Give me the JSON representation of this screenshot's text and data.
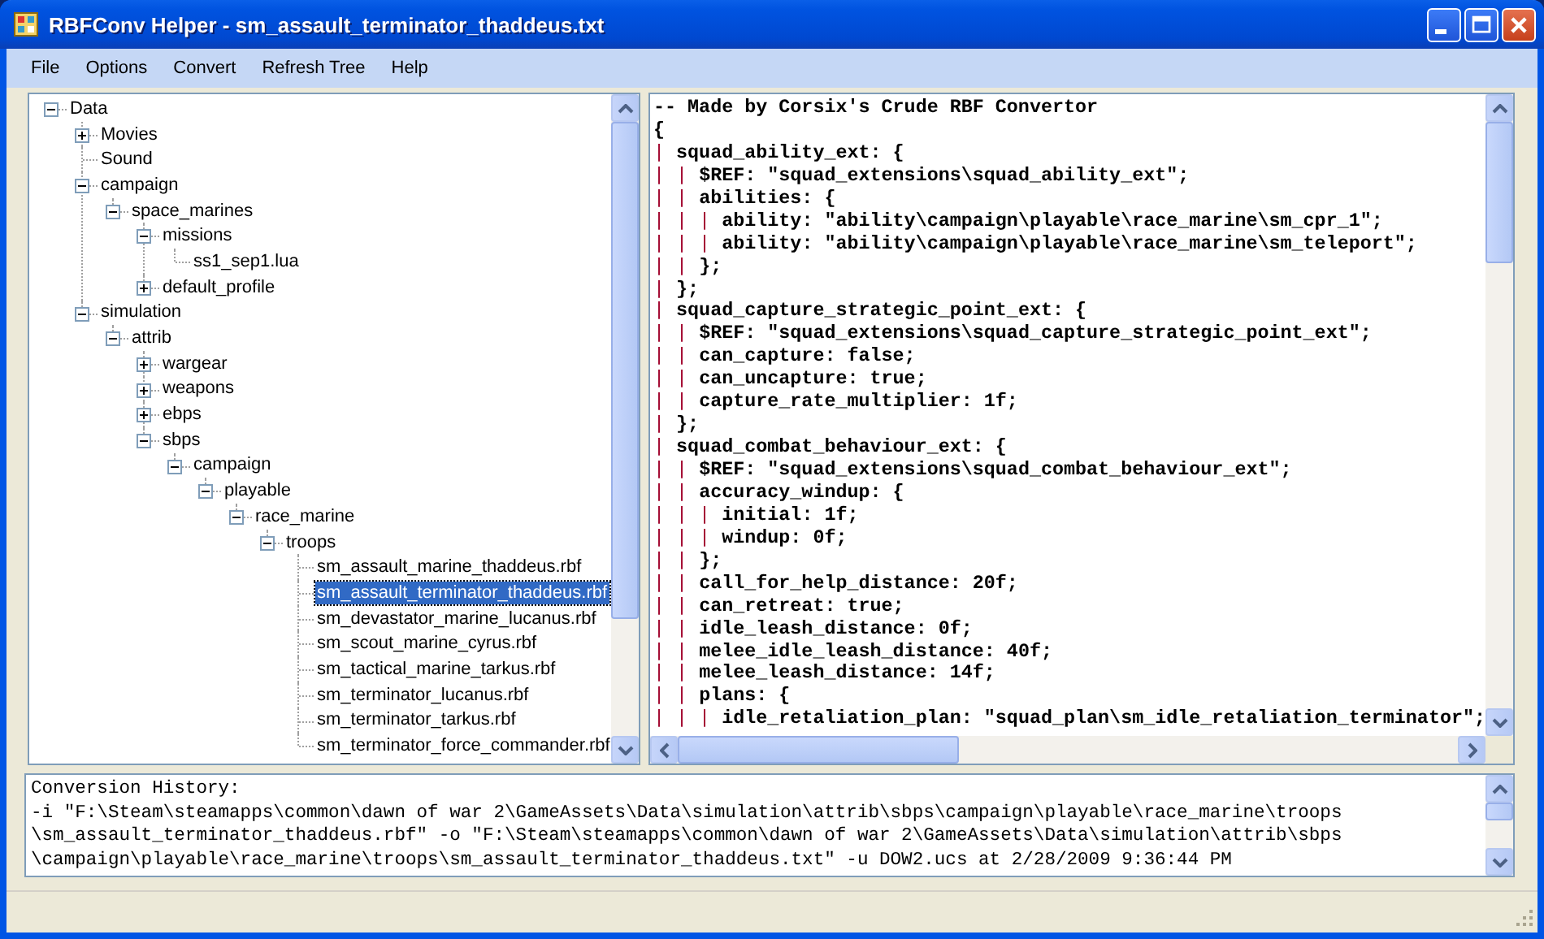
{
  "window": {
    "title": "RBFConv Helper - sm_assault_terminator_thaddeus.txt"
  },
  "menu": [
    "File",
    "Options",
    "Convert",
    "Refresh Tree",
    "Help"
  ],
  "tree": [
    {
      "label": "Data",
      "expanded": true,
      "selected": false,
      "children": [
        {
          "label": "Movies",
          "expanded": false,
          "selected": false
        },
        {
          "label": "Sound",
          "selected": false
        },
        {
          "label": "campaign",
          "expanded": true,
          "selected": false,
          "children": [
            {
              "label": "space_marines",
              "expanded": true,
              "selected": false,
              "children": [
                {
                  "label": "missions",
                  "expanded": true,
                  "selected": false,
                  "children": [
                    {
                      "label": "ss1_sep1.lua",
                      "selected": false
                    }
                  ]
                },
                {
                  "label": "default_profile",
                  "expanded": false,
                  "selected": false
                }
              ]
            }
          ]
        },
        {
          "label": "simulation",
          "expanded": true,
          "selected": false,
          "children": [
            {
              "label": "attrib",
              "expanded": true,
              "selected": false,
              "children": [
                {
                  "label": "wargear",
                  "expanded": false,
                  "selected": false
                },
                {
                  "label": "weapons",
                  "expanded": false,
                  "selected": false
                },
                {
                  "label": "ebps",
                  "expanded": false,
                  "selected": false
                },
                {
                  "label": "sbps",
                  "expanded": true,
                  "selected": false,
                  "children": [
                    {
                      "label": "campaign",
                      "expanded": true,
                      "selected": false,
                      "children": [
                        {
                          "label": "playable",
                          "expanded": true,
                          "selected": false,
                          "children": [
                            {
                              "label": "race_marine",
                              "expanded": true,
                              "selected": false,
                              "children": [
                                {
                                  "label": "troops",
                                  "expanded": true,
                                  "selected": false,
                                  "children": [
                                    {
                                      "label": "sm_assault_marine_thaddeus.rbf",
                                      "selected": false
                                    },
                                    {
                                      "label": "sm_assault_terminator_thaddeus.rbf",
                                      "selected": true
                                    },
                                    {
                                      "label": "sm_devastator_marine_lucanus.rbf",
                                      "selected": false
                                    },
                                    {
                                      "label": "sm_scout_marine_cyrus.rbf",
                                      "selected": false
                                    },
                                    {
                                      "label": "sm_tactical_marine_tarkus.rbf",
                                      "selected": false
                                    },
                                    {
                                      "label": "sm_terminator_lucanus.rbf",
                                      "selected": false
                                    },
                                    {
                                      "label": "sm_terminator_tarkus.rbf",
                                      "selected": false
                                    },
                                    {
                                      "label": "sm_terminator_force_commander.rbf",
                                      "selected": false
                                    }
                                  ]
                                }
                              ]
                            }
                          ]
                        }
                      ]
                    }
                  ]
                }
              ]
            }
          ]
        }
      ]
    }
  ],
  "editor_lines": [
    "-- Made by Corsix's Crude RBF Convertor",
    "{",
    "| squad_ability_ext: {",
    "| | $REF: \"squad_extensions\\squad_ability_ext\";",
    "| | abilities: {",
    "| | | ability: \"ability\\campaign\\playable\\race_marine\\sm_cpr_1\";",
    "| | | ability: \"ability\\campaign\\playable\\race_marine\\sm_teleport\";",
    "| | };",
    "| };",
    "| squad_capture_strategic_point_ext: {",
    "| | $REF: \"squad_extensions\\squad_capture_strategic_point_ext\";",
    "| | can_capture: false;",
    "| | can_uncapture: true;",
    "| | capture_rate_multiplier: 1f;",
    "| };",
    "| squad_combat_behaviour_ext: {",
    "| | $REF: \"squad_extensions\\squad_combat_behaviour_ext\";",
    "| | accuracy_windup: {",
    "| | | initial: 1f;",
    "| | | windup: 0f;",
    "| | };",
    "| | call_for_help_distance: 20f;",
    "| | can_retreat: true;",
    "| | idle_leash_distance: 0f;",
    "| | melee_idle_leash_distance: 40f;",
    "| | melee_leash_distance: 14f;",
    "| | plans: {",
    "| | | idle_retaliation_plan: \"squad_plan\\sm_idle_retaliation_terminator\";"
  ],
  "history_lines": [
    "Conversion History:",
    "-i \"F:\\Steam\\steamapps\\common\\dawn of war 2\\GameAssets\\Data\\simulation\\attrib\\sbps\\campaign\\playable\\race_marine\\troops",
    "\\sm_assault_terminator_thaddeus.rbf\" -o \"F:\\Steam\\steamapps\\common\\dawn of war 2\\GameAssets\\Data\\simulation\\attrib\\sbps",
    "\\campaign\\playable\\race_marine\\troops\\sm_assault_terminator_thaddeus.txt\" -u DOW2.ucs at 2/28/2009 9:36:44 PM"
  ]
}
